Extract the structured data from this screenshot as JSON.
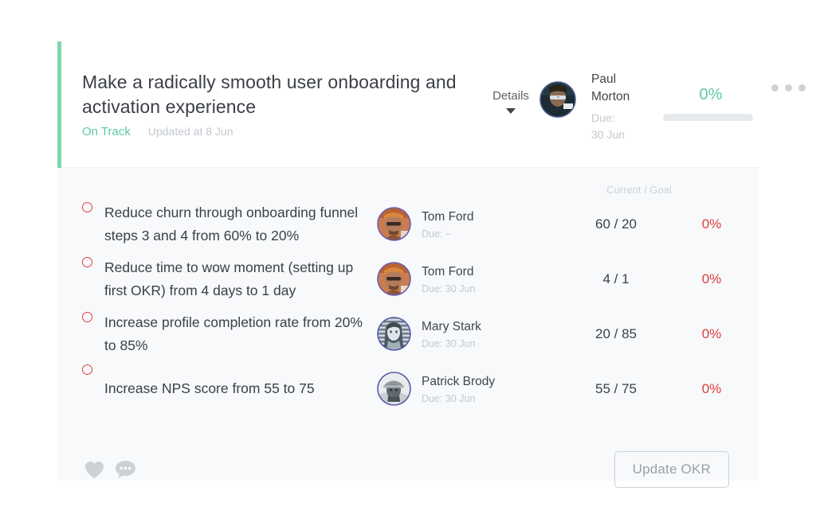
{
  "card": {
    "accent_color": "#7fd6ae",
    "header": {
      "title": "Make a radically smooth user onboarding and activation experience",
      "status": "On Track",
      "status_color": "#5ec9a0",
      "updated": "Updated at 8 Jun",
      "details_label": "Details",
      "owner": {
        "name_line1": "Paul",
        "name_line2": "Morton",
        "due_line1": "Due:",
        "due_line2": "30 Jun",
        "avatar_name": "paul-morton-avatar"
      },
      "progress": {
        "percent_label": "0%",
        "percent_value": 0,
        "color": "#5ec9a0"
      }
    },
    "key_results": {
      "column_header": "Current / Goal",
      "rows": [
        {
          "title": "Reduce churn through onboarding funnel steps 3 and 4 from 60% to 20%",
          "owner": "Tom Ford",
          "due": "Due: –",
          "metric": "60 / 20",
          "current": 60,
          "goal": 20,
          "percent": "0%",
          "percent_color": "#e23b3b",
          "avatar_name": "tom-ford-avatar"
        },
        {
          "title": "Reduce time to wow moment (setting up first OKR) from 4 days to 1 day",
          "owner": "Tom Ford",
          "due": "Due: 30 Jun",
          "metric": "4 / 1",
          "current": 4,
          "goal": 1,
          "percent": "0%",
          "percent_color": "#e23b3b",
          "avatar_name": "tom-ford-avatar"
        },
        {
          "title": "Increase profile completion rate from 20% to 85%",
          "owner": "Mary Stark",
          "due": "Due: 30 Jun",
          "metric": "20 / 85",
          "current": 20,
          "goal": 85,
          "percent": "0%",
          "percent_color": "#e23b3b",
          "avatar_name": "mary-stark-avatar"
        },
        {
          "title": "Increase NPS score from 55 to 75",
          "owner": "Patrick Brody",
          "due": "Due: 30 Jun",
          "metric": "55 / 75",
          "current": 55,
          "goal": 75,
          "percent": "0%",
          "percent_color": "#e23b3b",
          "avatar_name": "patrick-brody-avatar"
        }
      ]
    },
    "footer": {
      "like_icon": "heart-icon",
      "comment_icon": "comment-bubble-icon",
      "update_button": "Update OKR"
    },
    "overflow_menu_icon": "more-horizontal-icon"
  }
}
